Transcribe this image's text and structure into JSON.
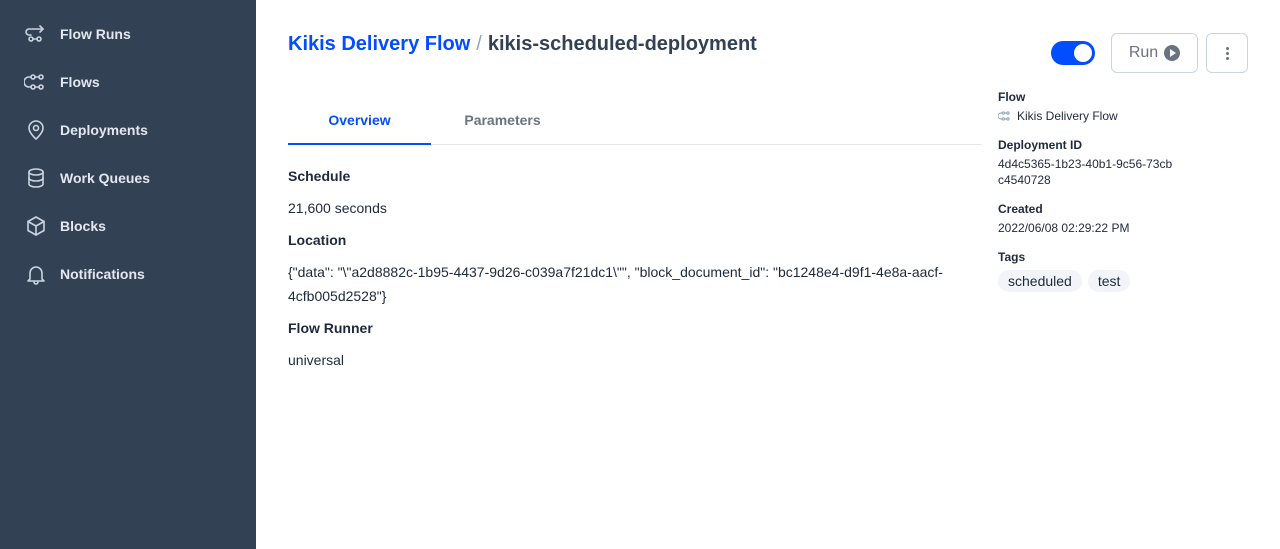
{
  "sidebar": {
    "items": [
      {
        "label": "Flow Runs",
        "icon": "flow-runs-icon"
      },
      {
        "label": "Flows",
        "icon": "flows-icon"
      },
      {
        "label": "Deployments",
        "icon": "map-pin-icon"
      },
      {
        "label": "Work Queues",
        "icon": "database-icon"
      },
      {
        "label": "Blocks",
        "icon": "cube-icon"
      },
      {
        "label": "Notifications",
        "icon": "bell-icon"
      }
    ]
  },
  "header": {
    "breadcrumb_parent": "Kikis Delivery Flow",
    "separator": "/",
    "title": "kikis-scheduled-deployment",
    "toggle_on": true,
    "run_label": "Run"
  },
  "tabs": [
    {
      "label": "Overview",
      "active": true
    },
    {
      "label": "Parameters",
      "active": false
    }
  ],
  "overview": {
    "schedule_label": "Schedule",
    "schedule_value": "21,600 seconds",
    "location_label": "Location",
    "location_value": "{\"data\": \"\\\"a2d8882c-1b95-4437-9d26-c039a7f21dc1\\\"\", \"block_document_id\": \"bc1248e4-d9f1-4e8a-aacf-4cfb005d2528\"}",
    "flow_runner_label": "Flow Runner",
    "flow_runner_value": "universal"
  },
  "details": {
    "flow_label": "Flow",
    "flow_value": "Kikis Delivery Flow",
    "deployment_id_label": "Deployment ID",
    "deployment_id_value": "4d4c5365-1b23-40b1-9c56-73cbc4540728",
    "created_label": "Created",
    "created_value": "2022/06/08 02:29:22 PM",
    "tags_label": "Tags",
    "tags": [
      "scheduled",
      "test"
    ]
  },
  "colors": {
    "sidebar_bg": "#334155",
    "accent": "#024dfd"
  }
}
